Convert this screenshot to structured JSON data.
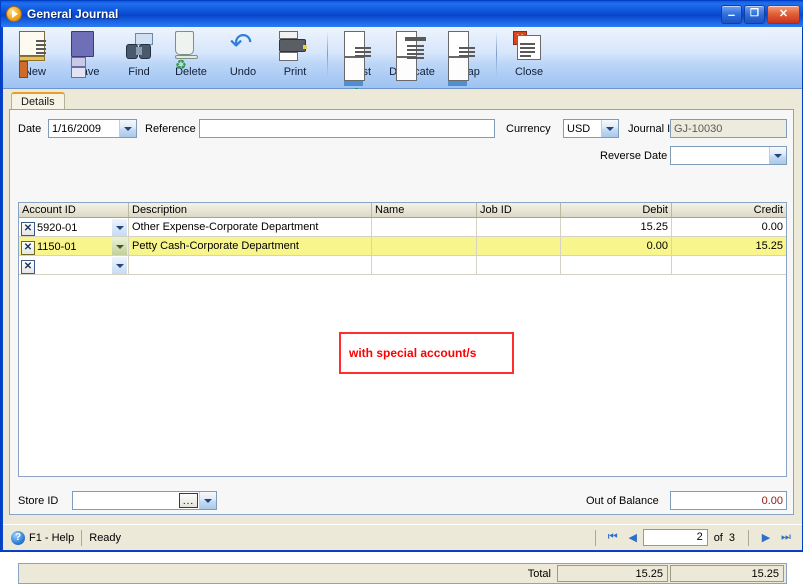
{
  "window": {
    "title": "General Journal",
    "icon": "journal-play-icon",
    "buttons": {
      "minimize": "–",
      "maximize": "❐",
      "close": "✕"
    }
  },
  "toolbar": {
    "items": [
      {
        "label": "New",
        "icon": "new-document-icon"
      },
      {
        "label": "Save",
        "icon": "floppy-disk-icon"
      },
      {
        "label": "Find",
        "icon": "binoculars-icon"
      },
      {
        "label": "Delete",
        "icon": "recycle-bin-icon"
      },
      {
        "label": "Undo",
        "icon": "undo-arrow-icon"
      },
      {
        "label": "Print",
        "icon": "printer-icon"
      },
      {
        "label": "Post",
        "icon": "post-checkmark-icon"
      },
      {
        "label": "Duplicate",
        "icon": "duplicate-pages-icon"
      },
      {
        "label": "Recap",
        "icon": "recap-report-icon"
      },
      {
        "label": "Close",
        "icon": "close-document-icon"
      }
    ]
  },
  "tabs": [
    {
      "label": "Details",
      "active": true
    }
  ],
  "form": {
    "date_label": "Date",
    "date_value": "1/16/2009",
    "reference_label": "Reference",
    "reference_value": "",
    "reference_placeholder": "",
    "currency_label": "Currency",
    "currency_value": "USD",
    "journal_id_label": "Journal ID",
    "journal_id_value": "GJ-10030",
    "reverse_date_label": "Reverse Date",
    "reverse_date_value": "",
    "store_id_label": "Store ID",
    "store_id_value": "",
    "out_of_balance_label": "Out of Balance",
    "out_of_balance_value": "0.00",
    "out_of_balance_color": "#8B1A10"
  },
  "grid": {
    "columns": [
      "Account ID",
      "Description",
      "Name",
      "Job ID",
      "Debit",
      "Credit"
    ],
    "rows": [
      {
        "account_id": "5920-01",
        "description": "Other Expense-Corporate Department",
        "name": "",
        "job_id": "",
        "debit": "15.25",
        "credit": "0.00",
        "selected": false,
        "delete_glyph": "✕"
      },
      {
        "account_id": "1150-01",
        "description": "Petty Cash-Corporate Department",
        "name": "",
        "job_id": "",
        "debit": "0.00",
        "credit": "15.25",
        "selected": true,
        "delete_glyph": "✕"
      },
      {
        "account_id": "",
        "description": "",
        "name": "",
        "job_id": "",
        "debit": "",
        "credit": "",
        "selected": false,
        "delete_glyph": "✕"
      }
    ],
    "total_label": "Total",
    "total_debit": "15.25",
    "total_credit": "15.25"
  },
  "annotation": {
    "text": "with special account/s",
    "color": "#FF0000",
    "border_color": "#FF2D2D"
  },
  "statusbar": {
    "help": "F1 - Help",
    "status": "Ready",
    "nav": {
      "first": "⏮",
      "prev": "◀",
      "record": "2",
      "of_label": "of",
      "total": "3",
      "next": "▶",
      "last": "⏭"
    }
  },
  "colors": {
    "title_blue": "#0A42C8",
    "selection_yellow": "#F7F58C",
    "panel_beige": "#ECE9D8"
  }
}
